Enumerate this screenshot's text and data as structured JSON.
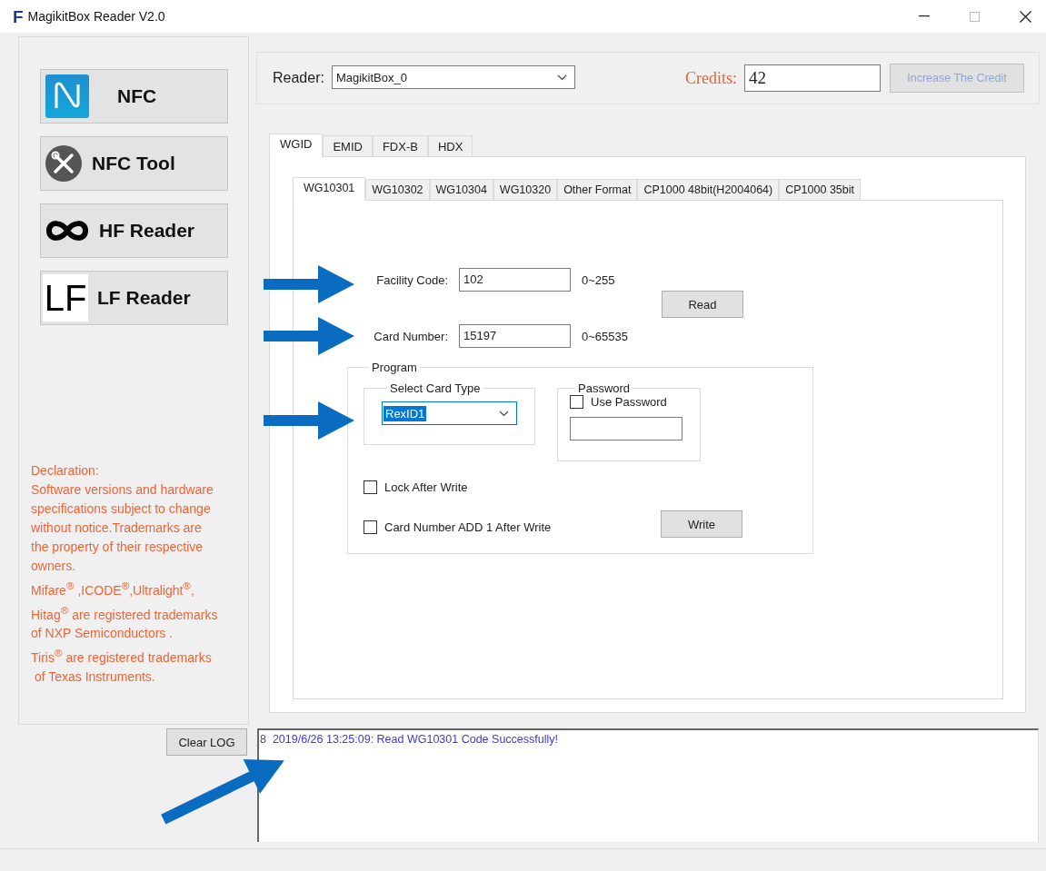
{
  "window": {
    "logo": "F",
    "title": "MagikitBox Reader V2.0"
  },
  "sidebar": {
    "buttons": [
      {
        "kind": "nfc",
        "label": "NFC"
      },
      {
        "kind": "tool",
        "label": "NFC Tool"
      },
      {
        "kind": "hf",
        "label": "HF Reader"
      },
      {
        "kind": "lf",
        "label": "LF Reader",
        "icon_text": "LF"
      }
    ],
    "declaration": {
      "heading": "Declaration:",
      "text": "Software versions and hardware\nspecifications subject to change\nwithout notice.Trademarks are\nthe property of their respective\nowners.\nMifare$^{®}$ ,ICODE$^{®}$,Ultralight$^{®}$,\nHitag$^{®}$ are registered trademarks\nof NXP Semiconductors .\nTiris$^{®}$ are registered trademarks\n of Texas Instruments."
    }
  },
  "reader": {
    "label": "Reader:",
    "value": "MagikitBox_0"
  },
  "credits": {
    "label": "Credits:",
    "value": "42",
    "button": {
      "label": "Increase The Credit",
      "disabled": true
    }
  },
  "tabs": [
    {
      "label": "WGID",
      "selected": true
    },
    {
      "label": "EMID",
      "selected": false
    },
    {
      "label": "FDX-B",
      "selected": false
    },
    {
      "label": "HDX",
      "selected": false
    }
  ],
  "subtabs": [
    {
      "label": "WG10301",
      "selected": true
    },
    {
      "label": "WG10302",
      "selected": false
    },
    {
      "label": "WG10304",
      "selected": false
    },
    {
      "label": "WG10320",
      "selected": false
    },
    {
      "label": "Other Format",
      "selected": false
    },
    {
      "label": "CP1000 48bit(H2004064)",
      "selected": false
    },
    {
      "label": "CP1000 35bit",
      "selected": false
    }
  ],
  "fields": [
    {
      "label": "Facility Code:",
      "value": "102",
      "range": "0~255"
    },
    {
      "label": "Card Number:",
      "value": "15197",
      "range": "0~65535"
    }
  ],
  "read_button": "Read",
  "program": {
    "title": "Program",
    "card_type": {
      "title": "Select Card Type",
      "value": "RexID1"
    },
    "password": {
      "title": "Password",
      "label": "Use Password",
      "checked": false
    },
    "options": [
      {
        "label": "Lock After Write",
        "checked": false
      },
      {
        "label": "Card Number ADD 1 After Write",
        "checked": false
      }
    ],
    "write_button": "Write"
  },
  "log": {
    "clear_button": "Clear LOG",
    "entries": [
      "8  2019/6/26 13:25:09: Read WG10301 Code Successfully!"
    ]
  }
}
